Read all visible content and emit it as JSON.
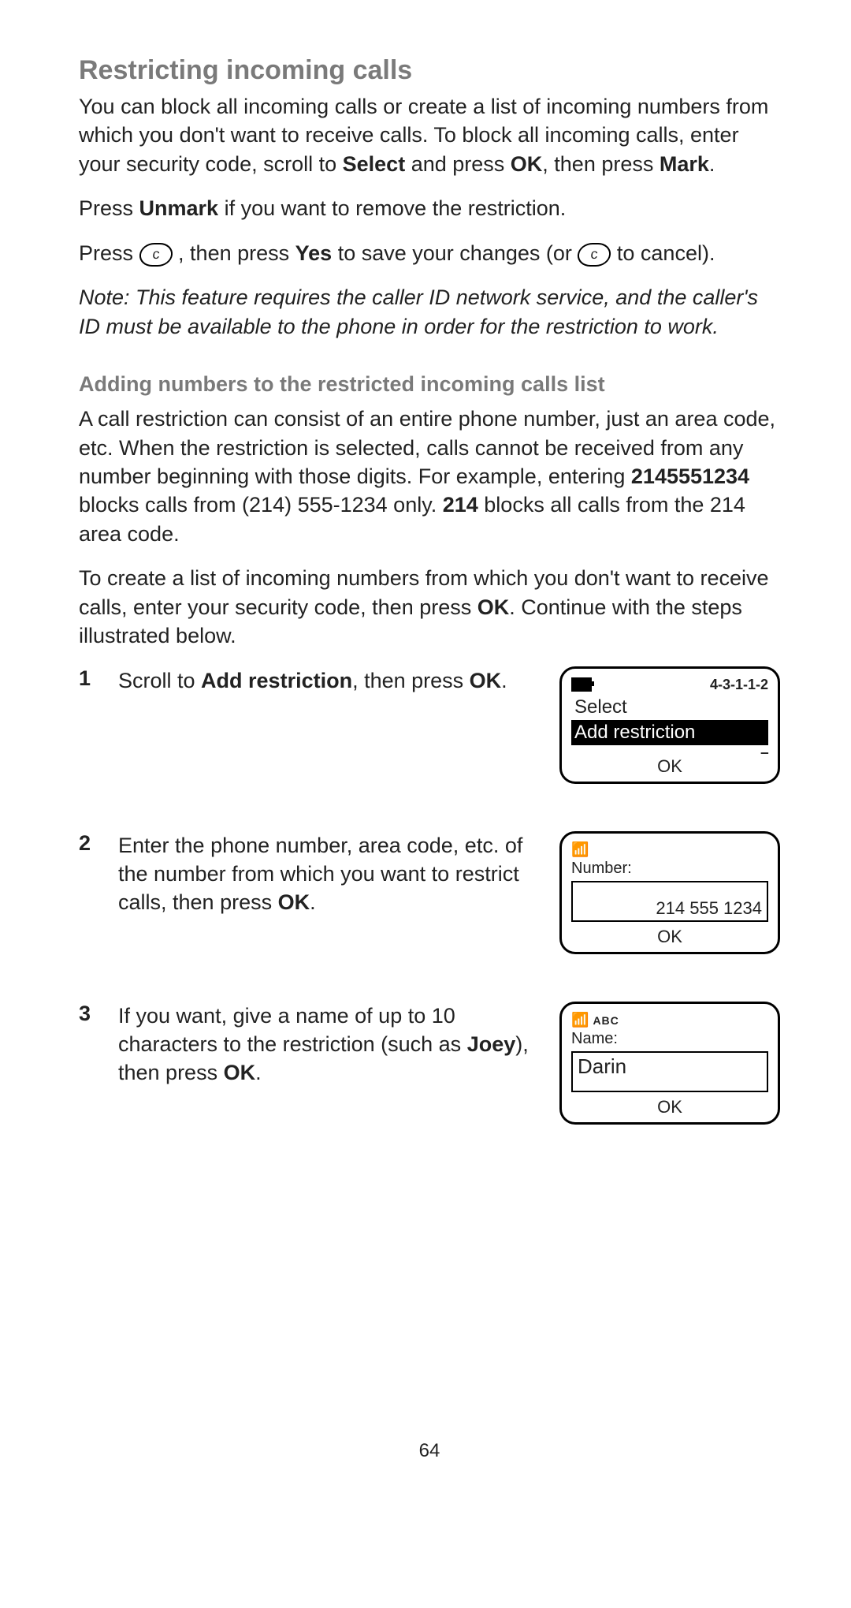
{
  "title": "Restricting incoming calls",
  "p1_a": "You can block all incoming calls or create a list of incoming numbers from which you don't want to receive calls. To block all incoming calls, enter your security code, scroll to ",
  "p1_b1": "Select",
  "p1_c": " and press ",
  "p1_b2": "OK",
  "p1_d": ", then press ",
  "p1_b3": "Mark",
  "p1_e": ".",
  "p2_a": "Press ",
  "p2_b1": "Unmark",
  "p2_c": " if you want to remove the restriction.",
  "p3_a": "Press ",
  "p3_b": " , then press ",
  "p3_b1": "Yes",
  "p3_c": " to save your changes (or ",
  "p3_d": " to cancel).",
  "note": "Note: This feature requires the caller ID network service, and the caller's ID must be available to the phone in order for the restriction to work.",
  "subhead": "Adding numbers to the restricted incoming calls list",
  "p4_a": "A call restriction can consist of an entire phone number, just an area code, etc. When the restriction is selected, calls cannot be received from any number beginning with those digits. For example, entering ",
  "p4_b1": "2145551234",
  "p4_b": " blocks calls from (214) 555-1234 only. ",
  "p4_b2": "214",
  "p4_c": " blocks all calls from the 214 area code.",
  "p5_a": "To create a list of incoming numbers from which you don't want to receive calls, enter your security code, then press ",
  "p5_b1": "OK",
  "p5_b": ". Continue with the steps illustrated below.",
  "steps": {
    "s1": {
      "num": "1",
      "t_a": "Scroll to ",
      "t_b1": "Add restriction",
      "t_b": ", then press ",
      "t_b2": "OK",
      "t_c": ".",
      "screen": {
        "menupath": "4-3-1-1-2",
        "line1": "Select",
        "line2": "Add restriction",
        "softkey": "OK"
      }
    },
    "s2": {
      "num": "2",
      "t_a": "Enter the phone number, area code, etc. of the number from which you want to restrict calls, then press ",
      "t_b1": "OK",
      "t_b": ".",
      "screen": {
        "label": "Number:",
        "value": "214 555 1234",
        "softkey": "OK"
      }
    },
    "s3": {
      "num": "3",
      "t_a": "If you want, give a name of up to 10 characters to the restriction (such as ",
      "t_b1": "Joey",
      "t_b": "), then press ",
      "t_b2": "OK",
      "t_c": ".",
      "screen": {
        "mode": "ABC",
        "label": "Name:",
        "value": "Darin",
        "softkey": "OK"
      }
    }
  },
  "page_number": "64",
  "c_key_label": "c"
}
